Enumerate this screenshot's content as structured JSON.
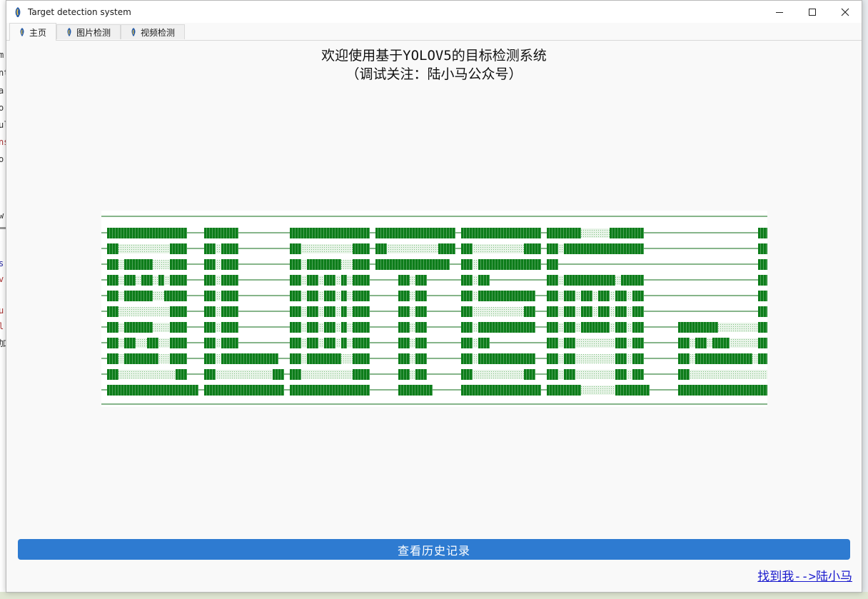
{
  "window": {
    "title": "Target detection system",
    "controls": {
      "minimize": "minimize-icon",
      "maximize": "maximize-icon",
      "close": "close-icon"
    }
  },
  "tabs": [
    {
      "label": "主页",
      "active": true
    },
    {
      "label": "图片检测",
      "active": false
    },
    {
      "label": "视频检测",
      "active": false
    }
  ],
  "home": {
    "title_line1": "欢迎使用基于YOLOV5的目标检测系统",
    "title_line2": "（调试关注：陆小马公众号）",
    "history_button": "查看历史记录",
    "find_me_link": "找到我-->陆小马"
  },
  "banner": {
    "kind": "ascii-art-block-letters",
    "colors": {
      "block": "#0d7d1a",
      "fill": "#bfe1bf",
      "rule": "#0d6b16"
    }
  },
  "background": {
    "left_fragments": [
      "m",
      "nt",
      "a",
      "o",
      "ul",
      "ns",
      "o",
      "w",
      "s",
      "v",
      "u",
      "l",
      "加"
    ]
  }
}
